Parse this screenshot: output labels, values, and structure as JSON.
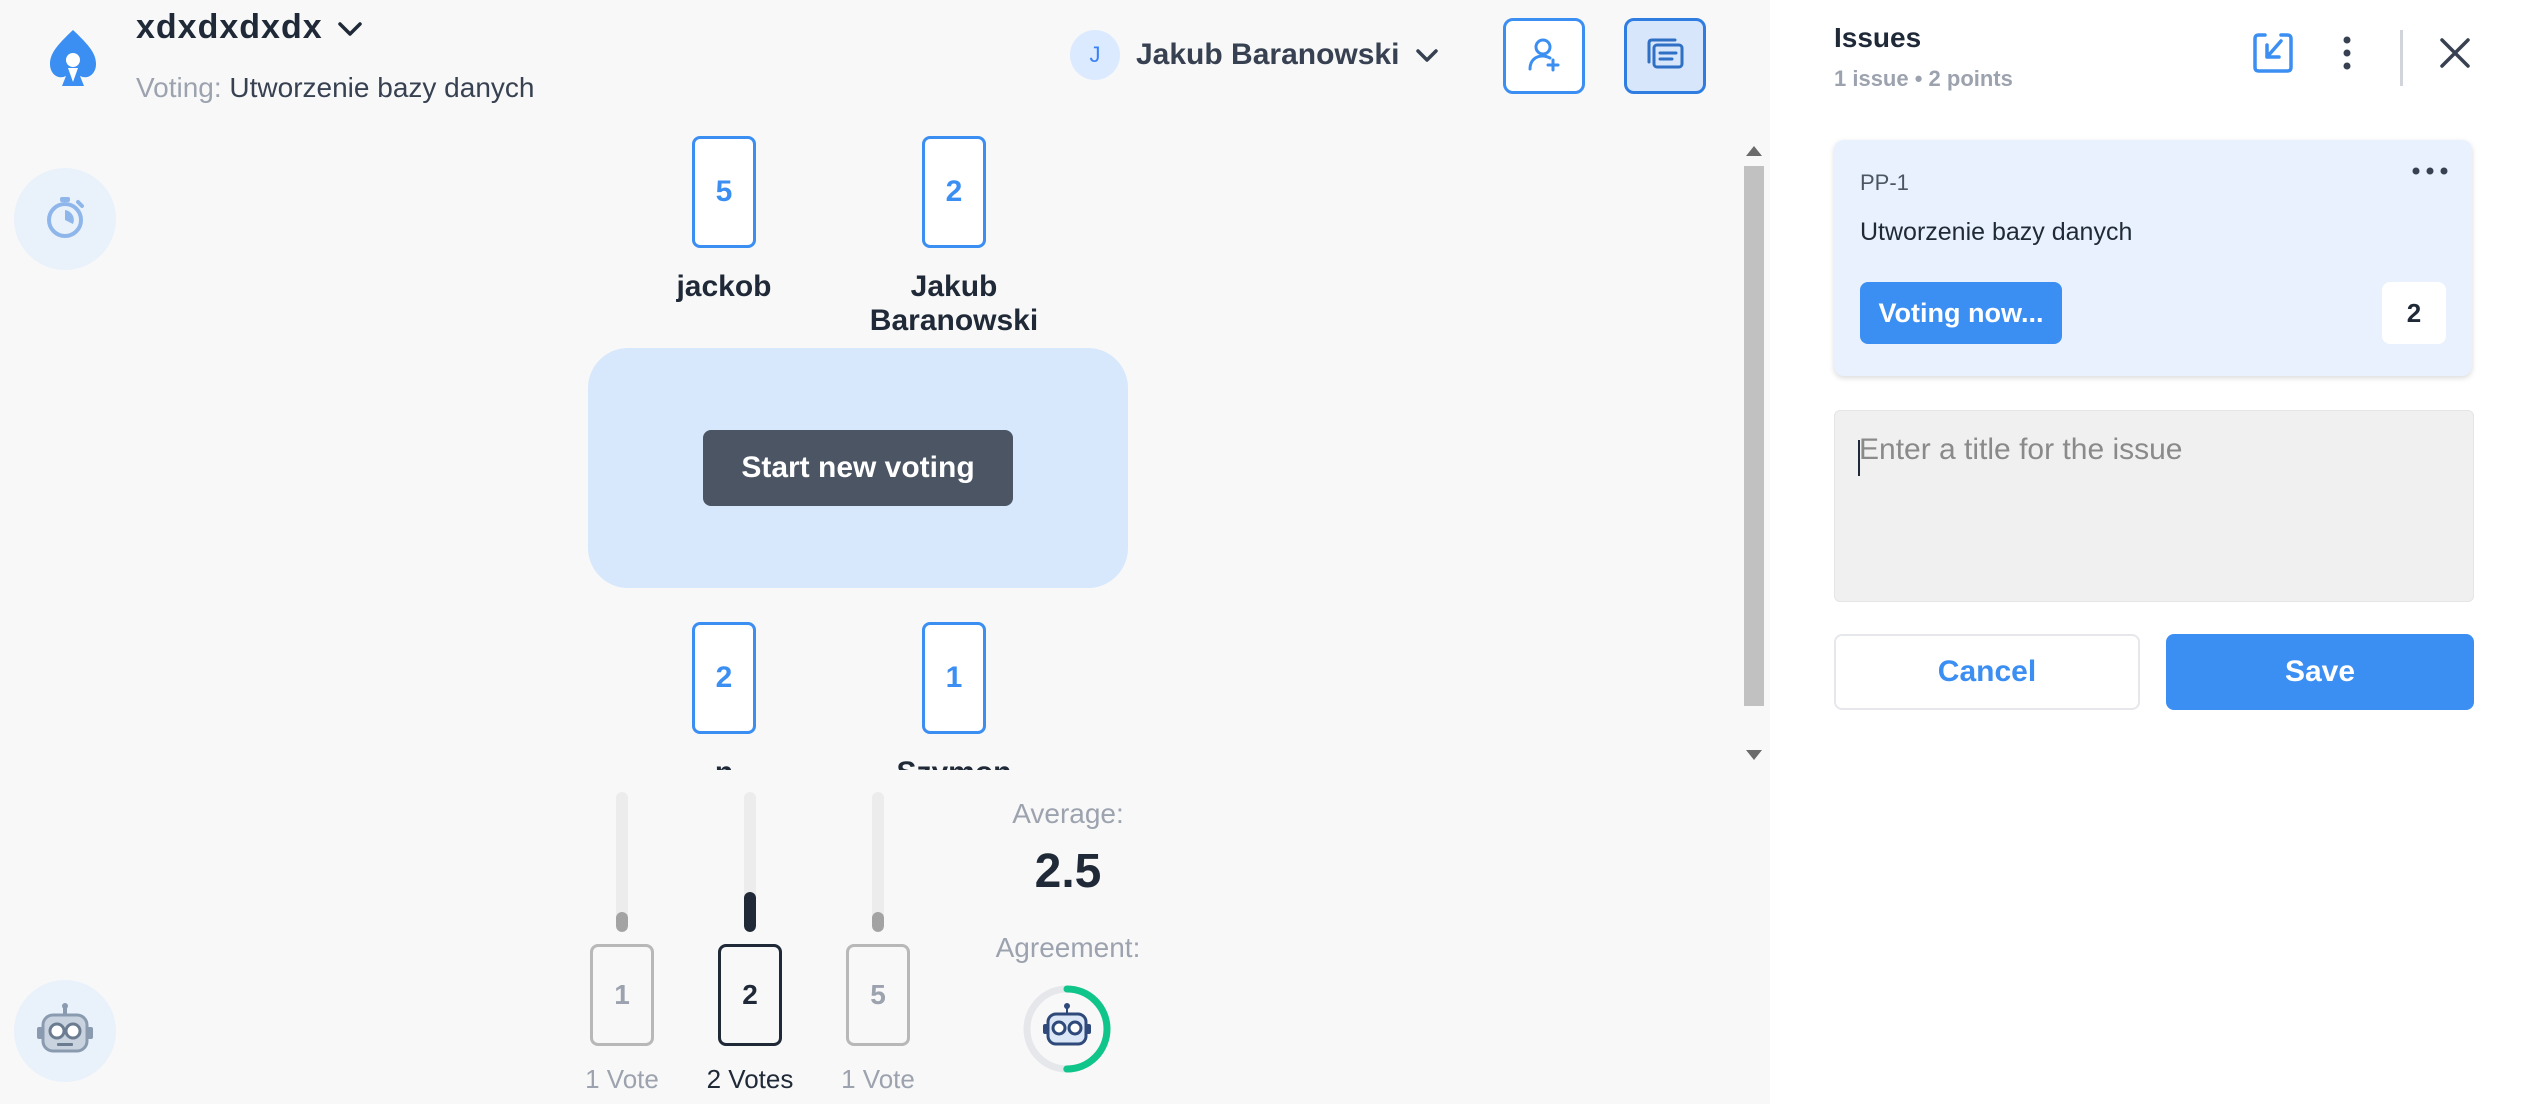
{
  "colors": {
    "accent": "#3b8ef2",
    "accent_light": "#d7e8fd",
    "dark_button": "#4b5563",
    "agreement_green": "#10c58a",
    "panel_bg": "#ffffff",
    "canvas_bg": "#f8f8f8"
  },
  "header": {
    "room_name": "xdxdxdxdx",
    "voting_label": "Voting:",
    "voting_issue": "Utworzenie bazy danych",
    "user": {
      "initial": "J",
      "name": "Jakub Baranowski"
    },
    "icons": [
      "rocket-logo-icon",
      "chevron-down-icon",
      "invite-player-icon",
      "issues-list-icon",
      "timer-icon",
      "robot-icon"
    ]
  },
  "table": {
    "top_players": [
      {
        "name": "jackob",
        "card": "5"
      },
      {
        "name": "Jakub Baranowski",
        "card": "2"
      }
    ],
    "bottom_players": [
      {
        "name": "n",
        "card": "2"
      },
      {
        "name": "Szymon",
        "card": "1"
      }
    ],
    "start_button": "Start new voting"
  },
  "results": {
    "options": [
      {
        "card": "1",
        "votes_label": "1 Vote",
        "share": 0.25
      },
      {
        "card": "2",
        "votes_label": "2 Votes",
        "share": 0.5
      },
      {
        "card": "5",
        "votes_label": "1 Vote",
        "share": 0.25
      }
    ],
    "average_label": "Average:",
    "average_value": "2.5",
    "agreement_label": "Agreement:",
    "agreement_fraction": 0.5
  },
  "issues_panel": {
    "title": "Issues",
    "summary": "1 issue • 2 points",
    "icons": [
      "import-issues-icon",
      "more-vertical-icon",
      "close-icon",
      "more-horizontal-icon"
    ],
    "issues": [
      {
        "key": "PP-1",
        "title": "Utworzenie bazy danych",
        "status_button": "Voting now...",
        "points": "2"
      }
    ],
    "new_issue": {
      "placeholder": "Enter a title for the issue",
      "value": "",
      "cancel_label": "Cancel",
      "save_label": "Save"
    }
  }
}
